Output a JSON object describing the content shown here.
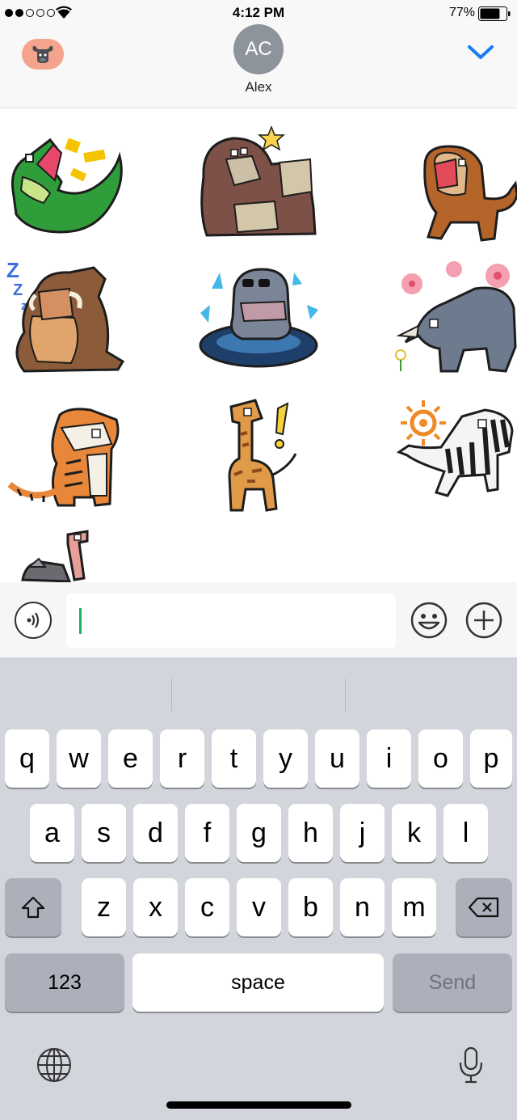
{
  "status_bar": {
    "time": "4:12 PM",
    "battery_percent": "77%",
    "signal_bars_filled": 2,
    "signal_bars_total": 5,
    "battery_level": 0.77
  },
  "header": {
    "contact_initials": "AC",
    "contact_name": "Alex",
    "app_icon": "water-buffalo-sticker-app-icon",
    "collapse_icon": "chevron-down-icon",
    "accent_color": "#1a7cf5"
  },
  "stickers": [
    {
      "name": "crocodile-sticker"
    },
    {
      "name": "gorilla-sticker"
    },
    {
      "name": "lion-sticker"
    },
    {
      "name": "warthog-sleeping-sticker"
    },
    {
      "name": "hippo-sunglasses-sticker"
    },
    {
      "name": "rhino-flowers-sticker"
    },
    {
      "name": "tiger-sticker"
    },
    {
      "name": "giraffe-exclaim-sticker"
    },
    {
      "name": "zebra-sun-sticker"
    },
    {
      "name": "ostrich-sticker"
    }
  ],
  "input_bar": {
    "voice_icon": "voice-waves-icon",
    "emoji_icon": "smiley-icon",
    "add_icon": "plus-circle-icon",
    "caret_color": "#1fb15b"
  },
  "keyboard": {
    "row1": [
      "q",
      "w",
      "e",
      "r",
      "t",
      "y",
      "u",
      "i",
      "o",
      "p"
    ],
    "row2": [
      "a",
      "s",
      "d",
      "f",
      "g",
      "h",
      "j",
      "k",
      "l"
    ],
    "row3": [
      "z",
      "x",
      "c",
      "v",
      "b",
      "n",
      "m"
    ],
    "numbers_label": "123",
    "space_label": "space",
    "send_label": "Send",
    "shift_icon": "shift-icon",
    "delete_icon": "delete-backspace-icon",
    "globe_icon": "globe-icon",
    "mic_icon": "microphone-icon"
  }
}
